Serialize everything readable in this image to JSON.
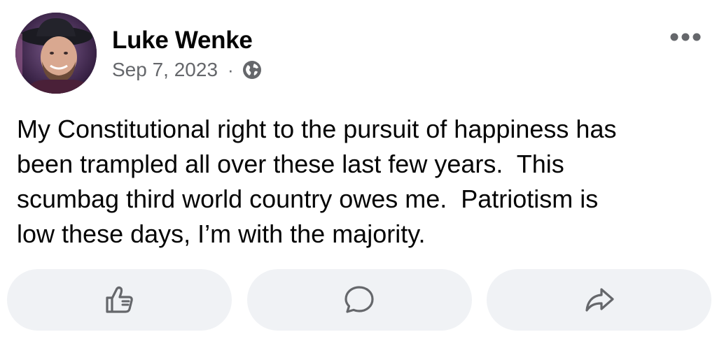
{
  "post": {
    "author": "Luke Wenke",
    "date": "Sep 7, 2023",
    "separator": "·",
    "audience_icon": "globe-icon",
    "more_icon": "more-options-icon",
    "text": "My Constitutional right to the pursuit of happiness has\nbeen trampled all over these last few years.  This\nscumbag third world country owes me.  Patriotism is\nlow these days, I’m with the majority."
  },
  "actions": [
    {
      "icon": "like-icon"
    },
    {
      "icon": "comment-icon"
    },
    {
      "icon": "share-icon"
    }
  ],
  "colors": {
    "text_primary": "#050505",
    "text_secondary": "#65676b",
    "button_bg": "#f0f2f5"
  }
}
